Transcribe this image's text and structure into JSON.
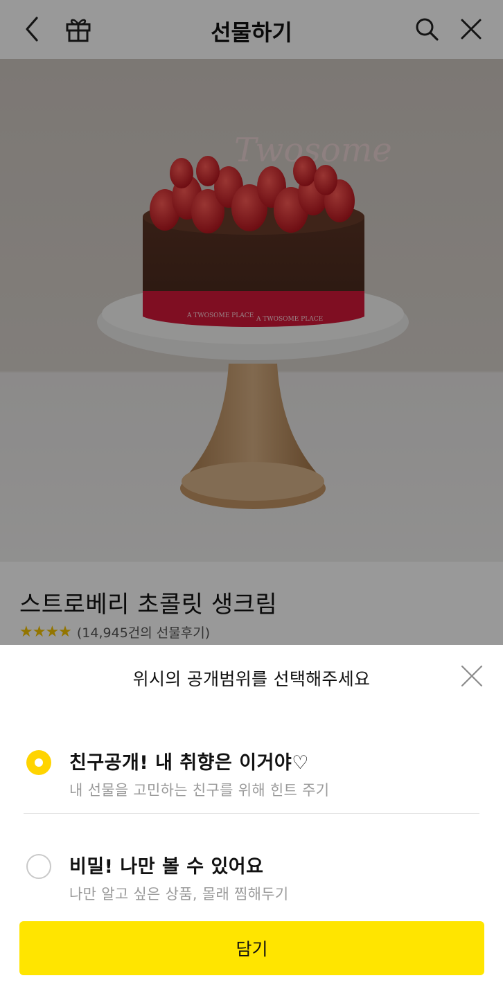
{
  "header": {
    "title": "선물하기",
    "icons": {
      "back": "chevron-left-icon",
      "gift": "gift-icon",
      "search": "search-icon",
      "close": "close-icon"
    }
  },
  "product": {
    "name": "스트로베리 초콜릿 생크림",
    "stars": "★★★★",
    "review_count": "(14,945건의 선물후기)",
    "image": {
      "topper_text": "Twosome",
      "ribbon_text_1": "A TWOSOME PLACE",
      "ribbon_text_2": "A TWOSOME PLACE"
    }
  },
  "sheet": {
    "title": "위시의 공개범위를 선택해주세요",
    "options": [
      {
        "title": "친구공개! 내 취향은 이거야♡",
        "description": "내 선물을 고민하는 친구를 위해 힌트 주기",
        "selected": true
      },
      {
        "title": "비밀! 나만 볼 수 있어요",
        "description": "나만 알고 싶은 상품, 몰래 찜해두기",
        "selected": false
      }
    ],
    "confirm_label": "담기"
  },
  "colors": {
    "accent_yellow": "#ffe500",
    "radio_yellow": "#ffd400",
    "star_yellow": "#f5c400",
    "dim_overlay": "rgba(0,0,0,0.40)",
    "ribbon_red": "#d4183a"
  }
}
